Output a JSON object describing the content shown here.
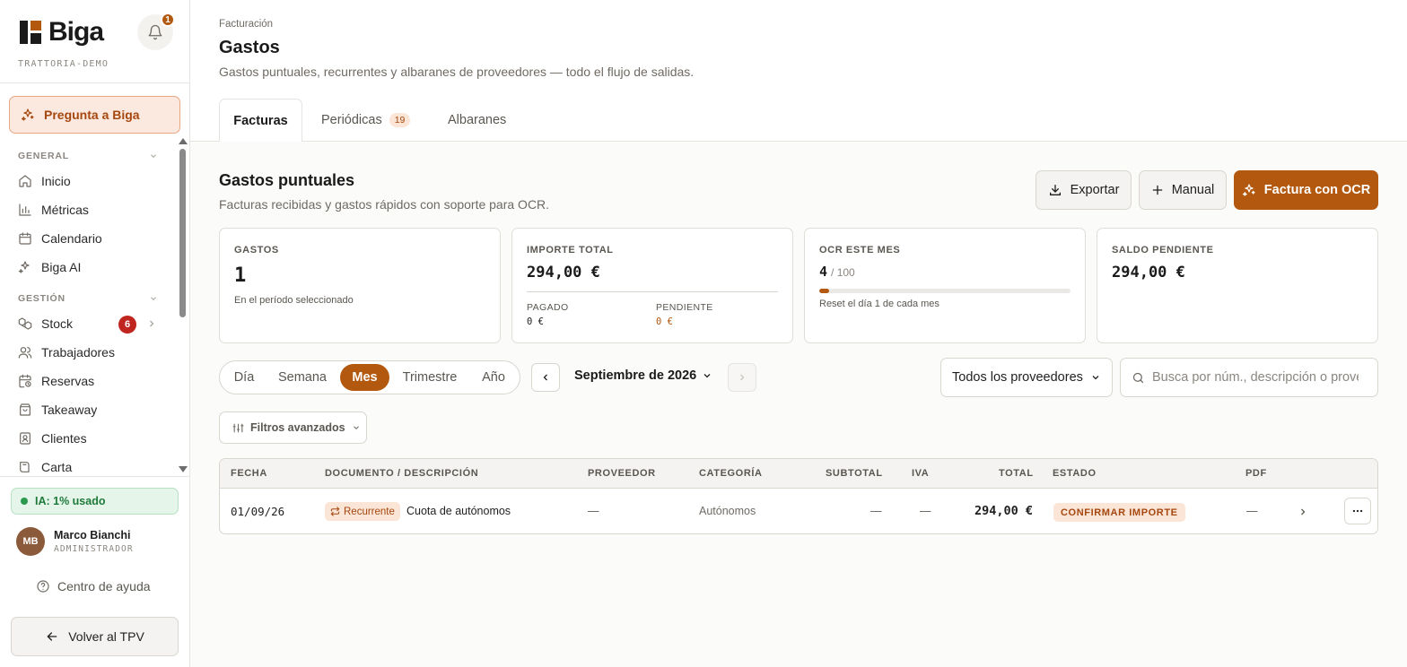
{
  "brand": {
    "name": "Biga",
    "org": "TRATTORIA-DEMO",
    "notif_count": "1",
    "accent": "#b3580f"
  },
  "sidebar": {
    "ask_label": "Pregunta a Biga",
    "general_label": "GENERAL",
    "gestion_label": "GESTIÓN",
    "items": [
      {
        "label": "Inicio",
        "icon": "home-icon"
      },
      {
        "label": "Métricas",
        "icon": "bar-chart-icon"
      },
      {
        "label": "Calendario",
        "icon": "calendar-icon"
      },
      {
        "label": "Biga AI",
        "icon": "sparkles-icon"
      },
      {
        "label": "Stock",
        "icon": "boxes-icon",
        "badge": "6"
      },
      {
        "label": "Trabajadores",
        "icon": "users-icon"
      },
      {
        "label": "Reservas",
        "icon": "calendar-clock-icon"
      },
      {
        "label": "Takeaway",
        "icon": "bag-icon"
      },
      {
        "label": "Clientes",
        "icon": "contact-icon"
      },
      {
        "label": "Carta",
        "icon": "book-icon"
      }
    ],
    "ia_usage": "IA: 1% usado",
    "user": {
      "initials": "MB",
      "name": "Marco Bianchi",
      "role": "ADMINISTRADOR"
    },
    "help_label": "Centro de ayuda",
    "back_label": "Volver al TPV"
  },
  "header": {
    "breadcrumb": "Facturación",
    "title": "Gastos",
    "subtitle": "Gastos puntuales, recurrentes y albaranes de proveedores — todo el flujo de salidas.",
    "tabs": [
      {
        "label": "Facturas"
      },
      {
        "label": "Periódicas",
        "count": "19"
      },
      {
        "label": "Albaranes"
      }
    ]
  },
  "section": {
    "title": "Gastos puntuales",
    "subtitle": "Facturas recibidas y gastos rápidos con soporte para OCR.",
    "export_label": "Exportar",
    "manual_label": "Manual",
    "ocr_label": "Factura con OCR"
  },
  "cards": {
    "gastos": {
      "label": "GASTOS",
      "value": "1",
      "note": "En el período seleccionado"
    },
    "importe": {
      "label": "IMPORTE TOTAL",
      "value": "294,00 €",
      "paid_label": "PAGADO",
      "paid_value": "0 €",
      "pending_label": "PENDIENTE",
      "pending_value": "0 €"
    },
    "ocr": {
      "label": "OCR ESTE MES",
      "used": "4",
      "limit": "/ 100",
      "used_fraction": 0.04,
      "note": "Reset el día 1 de cada mes"
    },
    "saldo": {
      "label": "SALDO PENDIENTE",
      "value": "294,00 €"
    }
  },
  "filters": {
    "periods": [
      "Día",
      "Semana",
      "Mes",
      "Trimestre",
      "Año"
    ],
    "active_period": "Mes",
    "month": "Septiembre de 2026",
    "provider": "Todos los proveedores",
    "search_placeholder": "Busca por núm., descripción o proveedor",
    "advanced_label": "Filtros avanzados"
  },
  "table": {
    "headers": [
      "FECHA",
      "DOCUMENTO / DESCRIPCIÓN",
      "PROVEEDOR",
      "CATEGORÍA",
      "SUBTOTAL",
      "IVA",
      "TOTAL",
      "ESTADO",
      "PDF"
    ],
    "rows": [
      {
        "fecha": "01/09/26",
        "badge": "Recurrente",
        "descripcion": "Cuota de autónomos",
        "proveedor": "—",
        "categoria": "Autónomos",
        "subtotal": "—",
        "iva": "—",
        "total": "294,00 €",
        "estado": "CONFIRMAR IMPORTE",
        "pdf": "—"
      }
    ]
  }
}
